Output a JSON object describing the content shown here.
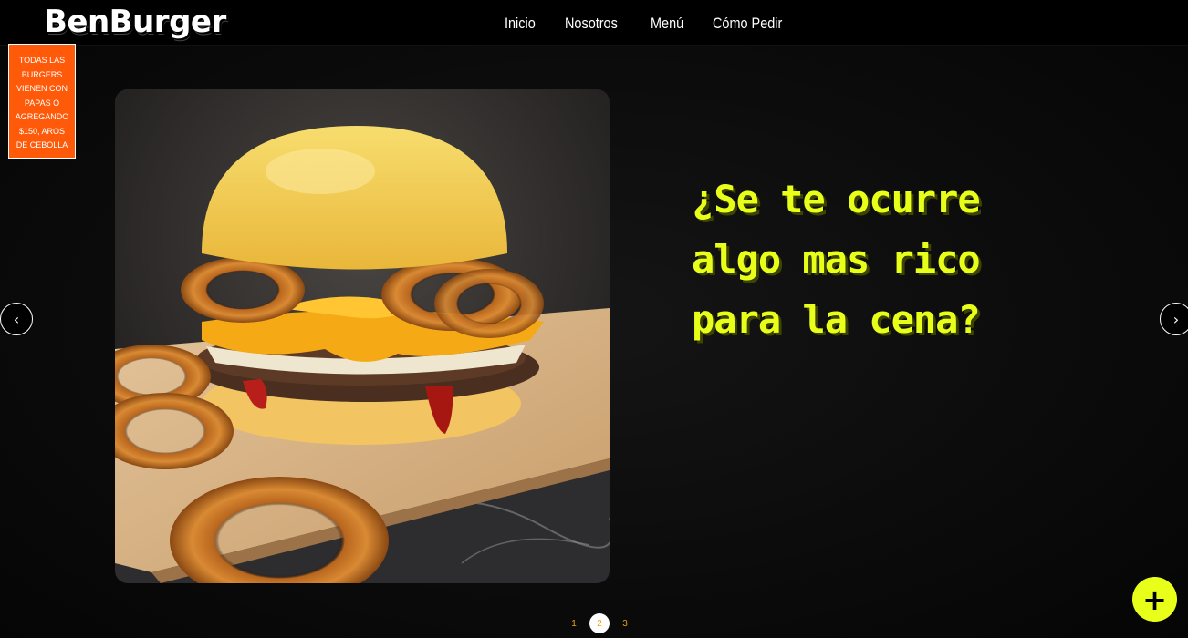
{
  "header": {
    "logo": "BenBurger",
    "nav": [
      "Inicio",
      "Nosotros",
      "Menú",
      "Cómo Pedir"
    ]
  },
  "promo": {
    "text": "TODAS LAS BURGERS VIENEN CON PAPAS O AGREGANDO $150, AROS DE CEBOLLA"
  },
  "slide": {
    "headline": "¿Se te ocurre algo mas rico para la cena?",
    "image": "burger-with-onion-rings"
  },
  "carousel": {
    "prev": "‹",
    "next": "›",
    "pages": [
      "1",
      "2",
      "3"
    ],
    "active_page": 2
  },
  "fab": {
    "label": "+"
  },
  "colors": {
    "accent": "#e8ff1a",
    "promo": "#ff5a0a",
    "pager": "#e8a20a"
  }
}
